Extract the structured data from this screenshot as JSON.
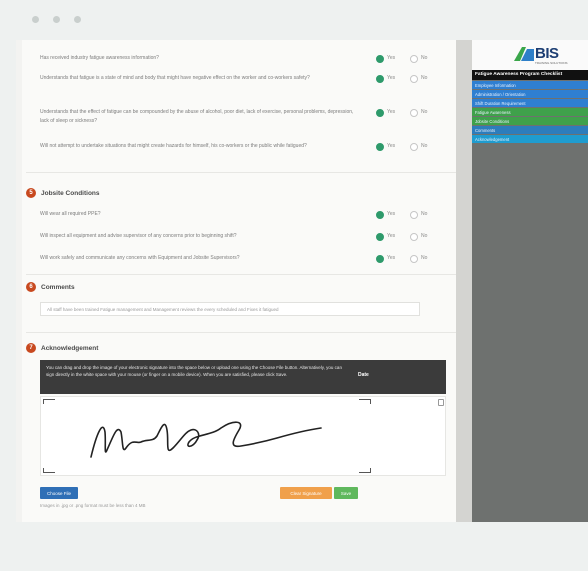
{
  "questions_top": [
    {
      "text": "Has received industry fatigue awareness information?",
      "yes": "Yes",
      "no": "No",
      "selected": "yes"
    },
    {
      "text": "Understands that fatigue is a state of mind and body that might have negative effect on the worker and co-workers safety?",
      "yes": "Yes",
      "no": "No",
      "selected": "yes"
    },
    {
      "text": "Understands that the effect of fatigue can be compounded by the abuse of alcohol, poor diet, lack of exercise, personal problems, depression, lack of sleep or sickness?",
      "yes": "Yes",
      "no": "No",
      "selected": "yes"
    },
    {
      "text": "Will not attempt to undertake situations that might create hazards for himself, his co-workers or the public while fatigued?",
      "yes": "Yes",
      "no": "No",
      "selected": "yes"
    }
  ],
  "section5": {
    "number": "5",
    "title": "Jobsite Conditions"
  },
  "questions_jobsite": [
    {
      "text": "Will wear all required PPE?",
      "yes": "Yes",
      "no": "No",
      "selected": "yes"
    },
    {
      "text": "Will inspect all equipment and advise supervisor of any concerns prior to beginning shift?",
      "yes": "Yes",
      "no": "No",
      "selected": "yes"
    },
    {
      "text": "Will work safely and communicate any concerns with Equipment and Jobsite Supervisors?",
      "yes": "Yes",
      "no": "No",
      "selected": "yes"
    }
  ],
  "section6": {
    "number": "6",
    "title": "Comments"
  },
  "comment_text": "All staff have been trained Fatigue management and Management reviews the every scheduled and Fixes it fatigued",
  "section7": {
    "number": "7",
    "title": "Acknowledgement"
  },
  "instructions": "You can drag and drop the image of your electronic signature into the space below or upload one using the Choose File button. Alternatively, you can sign directly in the white space with your mouse (or finger on a mobile device). When you are satisfied, please click Save.",
  "date_label": "Date",
  "buttons": {
    "choose_file": "Choose File",
    "clear": "Clear Signature",
    "save": "Save"
  },
  "hint": "Images in .jpg or .png format must be less than 4 MB",
  "sidebar": {
    "logo": "BIS",
    "logo_sub": "TRAINING SOLUTIONS",
    "title": "Fatigue Awareness Program Checklist",
    "items": [
      {
        "label": "Employee Information",
        "color": "blue"
      },
      {
        "label": "Administration / Orientation",
        "color": "blue"
      },
      {
        "label": "Shift Duration Requirement",
        "color": "blue"
      },
      {
        "label": "Fatigue Awareness",
        "color": "green"
      },
      {
        "label": "Jobsite Conditions",
        "color": "green"
      },
      {
        "label": "Comments",
        "color": "steel"
      },
      {
        "label": "Acknowledgement",
        "color": "cyan"
      }
    ]
  }
}
